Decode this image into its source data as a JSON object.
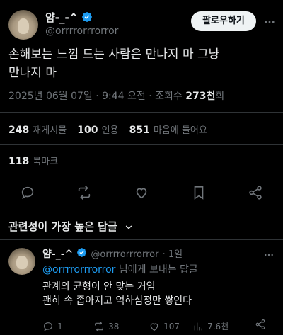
{
  "author": {
    "name": "얌-_-^",
    "handle": "@orrrrorrrorror",
    "follow_label": "팔로우하기"
  },
  "tweet": {
    "line1": "손해보는 느낌 드는 사람은 만나지 마 그냥",
    "line2": "만나지 마",
    "timestamp": "2025년 06월 07일 · 9:44 오전 · 조회수 ",
    "views": "273천",
    "views_suffix": "회"
  },
  "stats": {
    "reposts_count": "248",
    "reposts_label": "재게시물",
    "quotes_count": "100",
    "quotes_label": "인용",
    "likes_count": "851",
    "likes_label": "마음에 들어요",
    "bookmarks_count": "118",
    "bookmarks_label": "북마크"
  },
  "sort": {
    "label": "관련성이 가장 높은 답글"
  },
  "reply": {
    "name": "얌-_-^",
    "handle": "@orrrrorrrorror",
    "age": "· 1일",
    "to_handle": "@orrrrorrrorror",
    "to_suffix": " 님에게 보내는 답글",
    "line1": "관계의 균형이 안 맞는 거임",
    "line2": "괜히 속 좁아지고 억하심정만 쌓인다",
    "reply_count": "1",
    "repost_count": "38",
    "like_count": "107",
    "views_count": "7.6천"
  },
  "colors": {
    "background": "#000000",
    "text": "#e7e9ea",
    "muted": "#71767b",
    "accent": "#1d9bf0",
    "divider": "#2f3336"
  }
}
